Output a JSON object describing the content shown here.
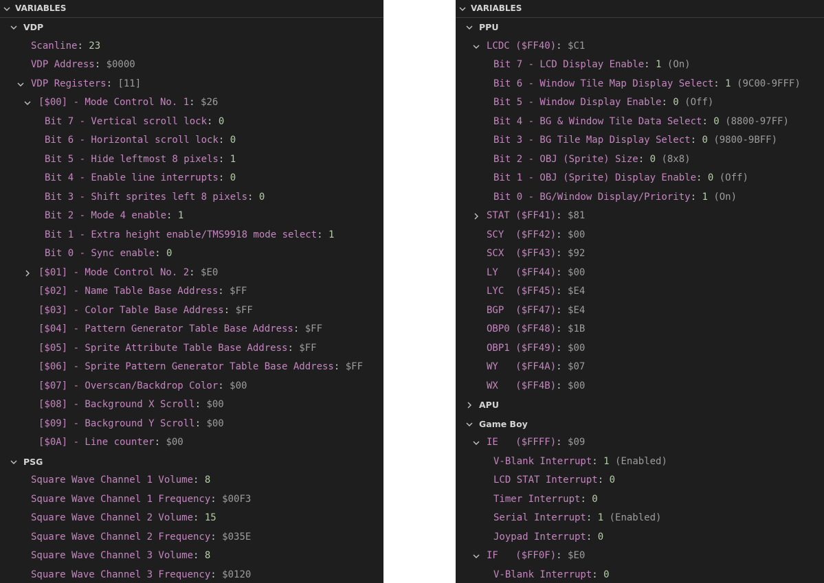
{
  "left": {
    "header": "VARIABLES",
    "rows": [
      {
        "d": 1,
        "tw": "down",
        "scope": true,
        "name": "VDP"
      },
      {
        "d": 2,
        "name": "Scanline",
        "num": "23"
      },
      {
        "d": 2,
        "name": "VDP Address",
        "hex": "$0000"
      },
      {
        "d": 2,
        "tw": "down",
        "name": "VDP Registers",
        "hex": "[11]"
      },
      {
        "d": 3,
        "tw": "down",
        "name": "[$00] - Mode Control No. 1",
        "hex": "$26"
      },
      {
        "d": 4,
        "name": "Bit 7 - Vertical scroll lock",
        "num": "0"
      },
      {
        "d": 4,
        "name": "Bit 6 - Horizontal scroll lock",
        "num": "0"
      },
      {
        "d": 4,
        "name": "Bit 5 - Hide leftmost 8 pixels",
        "num": "1"
      },
      {
        "d": 4,
        "name": "Bit 4 - Enable line interrupts",
        "num": "0"
      },
      {
        "d": 4,
        "name": "Bit 3 - Shift sprites left 8 pixels",
        "num": "0"
      },
      {
        "d": 4,
        "name": "Bit 2 - Mode 4 enable",
        "num": "1"
      },
      {
        "d": 4,
        "name": "Bit 1 - Extra height enable/TMS9918 mode select",
        "num": "1"
      },
      {
        "d": 4,
        "name": "Bit 0 - Sync enable",
        "num": "0"
      },
      {
        "d": 3,
        "tw": "right",
        "name": "[$01] - Mode Control No. 2",
        "hex": "$E0"
      },
      {
        "d": 3,
        "name": "[$02] - Name Table Base Address",
        "hex": "$FF"
      },
      {
        "d": 3,
        "name": "[$03] - Color Table Base Address",
        "hex": "$FF"
      },
      {
        "d": 3,
        "name": "[$04] - Pattern Generator Table Base Address",
        "hex": "$FF"
      },
      {
        "d": 3,
        "name": "[$05] - Sprite Attribute Table Base Address",
        "hex": "$FF"
      },
      {
        "d": 3,
        "name": "[$06] - Sprite Pattern Generator Table Base Address",
        "hex": "$FF"
      },
      {
        "d": 3,
        "name": "[$07] - Overscan/Backdrop Color",
        "hex": "$00"
      },
      {
        "d": 3,
        "name": "[$08] - Background X Scroll",
        "hex": "$00"
      },
      {
        "d": 3,
        "name": "[$09] - Background Y Scroll",
        "hex": "$00"
      },
      {
        "d": 3,
        "name": "[$0A] - Line counter",
        "hex": "$00"
      },
      {
        "d": 1,
        "tw": "down",
        "scope": true,
        "name": "PSG"
      },
      {
        "d": 2,
        "name": "Square Wave Channel 1 Volume",
        "num": "8"
      },
      {
        "d": 2,
        "name": "Square Wave Channel 1 Frequency",
        "hex": "$00F3"
      },
      {
        "d": 2,
        "name": "Square Wave Channel 2 Volume",
        "num": "15"
      },
      {
        "d": 2,
        "name": "Square Wave Channel 2 Frequency",
        "hex": "$035E"
      },
      {
        "d": 2,
        "name": "Square Wave Channel 3 Volume",
        "num": "8"
      },
      {
        "d": 2,
        "name": "Square Wave Channel 3 Frequency",
        "hex": "$0120"
      }
    ]
  },
  "right": {
    "header": "VARIABLES",
    "rows": [
      {
        "d": 1,
        "tw": "down",
        "scope": true,
        "name": "PPU"
      },
      {
        "d": 2,
        "tw": "down",
        "name": "LCDC ($FF40)",
        "hex": "$C1"
      },
      {
        "d": 3,
        "name": "Bit 7 - LCD Display Enable",
        "num": "1",
        "note": "(On)"
      },
      {
        "d": 3,
        "name": "Bit 6 - Window Tile Map Display Select",
        "num": "1",
        "note": "(9C00-9FFF)"
      },
      {
        "d": 3,
        "name": "Bit 5 - Window Display Enable",
        "num": "0",
        "note": "(Off)"
      },
      {
        "d": 3,
        "name": "Bit 4 - BG & Window Tile Data Select",
        "num": "0",
        "note": "(8800-97FF)"
      },
      {
        "d": 3,
        "name": "Bit 3 - BG Tile Map Display Select",
        "num": "0",
        "note": "(9800-9BFF)"
      },
      {
        "d": 3,
        "name": "Bit 2 - OBJ (Sprite) Size",
        "num": "0",
        "note": "(8x8)"
      },
      {
        "d": 3,
        "name": "Bit 1 - OBJ (Sprite) Display Enable",
        "num": "0",
        "note": "(Off)"
      },
      {
        "d": 3,
        "name": "Bit 0 - BG/Window Display/Priority",
        "num": "1",
        "note": "(On)"
      },
      {
        "d": 2,
        "tw": "right",
        "name": "STAT ($FF41)",
        "hex": "$81"
      },
      {
        "d": 2,
        "name": "SCY  ($FF42)",
        "hex": "$00"
      },
      {
        "d": 2,
        "name": "SCX  ($FF43)",
        "hex": "$92"
      },
      {
        "d": 2,
        "name": "LY   ($FF44)",
        "hex": "$00"
      },
      {
        "d": 2,
        "name": "LYC  ($FF45)",
        "hex": "$E4"
      },
      {
        "d": 2,
        "name": "BGP  ($FF47)",
        "hex": "$E4"
      },
      {
        "d": 2,
        "name": "OBP0 ($FF48)",
        "hex": "$1B"
      },
      {
        "d": 2,
        "name": "OBP1 ($FF49)",
        "hex": "$00"
      },
      {
        "d": 2,
        "name": "WY   ($FF4A)",
        "hex": "$07"
      },
      {
        "d": 2,
        "name": "WX   ($FF4B)",
        "hex": "$00"
      },
      {
        "d": 1,
        "tw": "right",
        "scope": true,
        "name": "APU"
      },
      {
        "d": 1,
        "tw": "down",
        "scope": true,
        "name": "Game Boy"
      },
      {
        "d": 2,
        "tw": "down",
        "name": "IE   ($FFFF)",
        "hex": "$09"
      },
      {
        "d": 3,
        "name": "V-Blank Interrupt",
        "num": "1",
        "note": "(Enabled)"
      },
      {
        "d": 3,
        "name": "LCD STAT Interrupt",
        "num": "0"
      },
      {
        "d": 3,
        "name": "Timer Interrupt",
        "num": "0"
      },
      {
        "d": 3,
        "name": "Serial Interrupt",
        "num": "1",
        "note": "(Enabled)"
      },
      {
        "d": 3,
        "name": "Joypad Interrupt",
        "num": "0"
      },
      {
        "d": 2,
        "tw": "down",
        "name": "IF   ($FF0F)",
        "hex": "$E0"
      },
      {
        "d": 3,
        "name": "V-Blank Interrupt",
        "num": "0"
      }
    ]
  },
  "colors": {
    "panel_bg": "#1e1e1e",
    "name": "#c586c0",
    "number": "#b5cea8",
    "hex_value": "#9d9d9d",
    "text": "#cccccc"
  }
}
